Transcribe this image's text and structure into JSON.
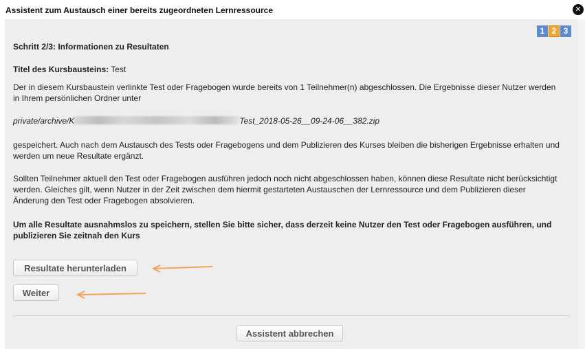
{
  "dialog": {
    "title": "Assistent zum Austausch einer bereits zugeordneten Lernressource",
    "close_label": "✕"
  },
  "steps": [
    "1",
    "2",
    "3"
  ],
  "step_title": "Schritt 2/3: Informationen zu Resultaten",
  "kurs": {
    "label": "Titel des Kursbausteins:",
    "value": "Test"
  },
  "paragraphs": {
    "p1": "Der in diesem Kursbaustein verlinkte Test oder Fragebogen wurde bereits von 1 Teilnehmer(n) abgeschlossen. Die Ergebnisse dieser Nutzer werden in Ihrem persönlichen Ordner unter",
    "path_start": "private/archive/K",
    "path_end": "Test_2018-05-26__09-24-06__382.zip",
    "p2": "gespeichert. Auch nach dem Austausch des Tests oder Fragebogens und dem Publizieren des Kurses bleiben die bisherigen Ergebnisse erhalten und werden um neue Resultate ergänzt.",
    "p3": "Sollten Teilnehmer aktuell den Test oder Fragebogen ausführen jedoch noch nicht abgeschlossen haben, können diese Resultate nicht berücksichtigt werden. Gleiches gilt, wenn Nutzer in der Zeit zwischen dem hiermit gestarteten Austauschen der Lernressource und dem Publizieren dieser Änderung den Test oder Fragebogen absolvieren.",
    "p4": "Um alle Resultate ausnahmslos zu speichern, stellen Sie bitte sicher, dass derzeit keine Nutzer den Test oder Fragebogen ausführen, und publizieren Sie zeitnah den Kurs"
  },
  "buttons": {
    "download": "Resultate herunterladen",
    "weiter": "Weiter",
    "cancel": "Assistent abbrechen"
  },
  "colors": {
    "panel_bg": "#eeeeee",
    "step_blue": "#5b89d6",
    "step_active": "#f3a532",
    "arrow": "#f3a25a"
  }
}
